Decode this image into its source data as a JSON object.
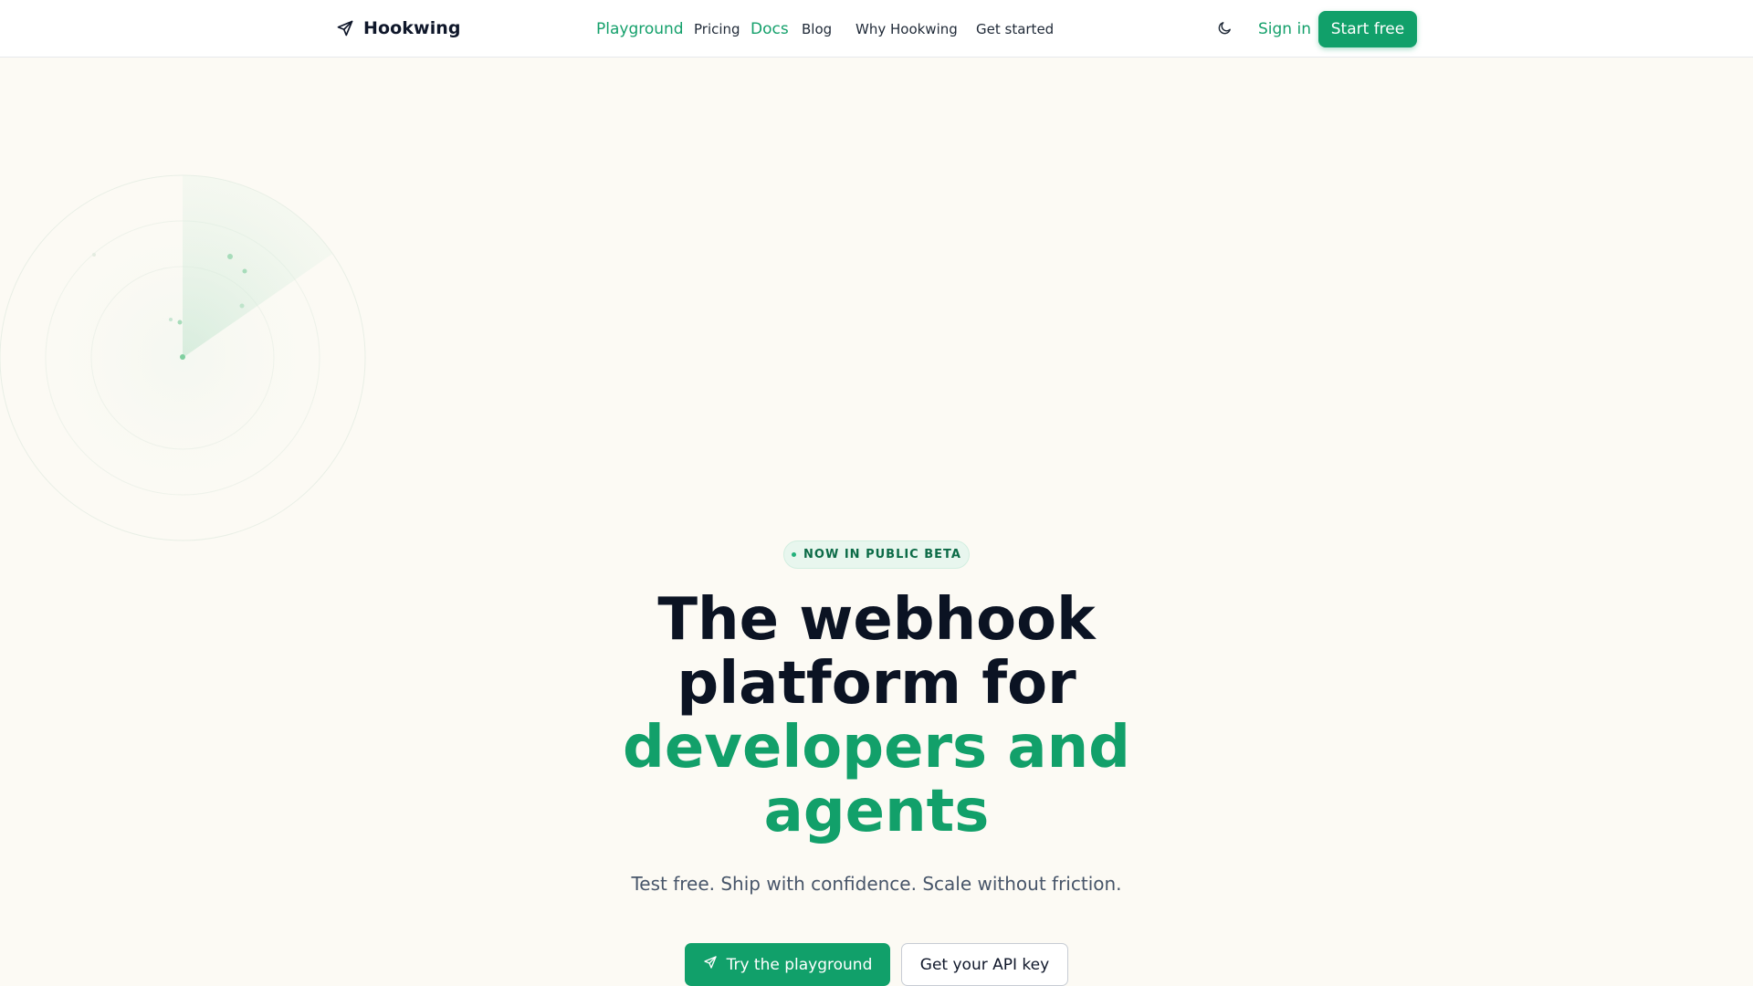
{
  "brand": {
    "name": "Hookwing",
    "icon": "paper-plane-icon"
  },
  "nav": {
    "items": [
      {
        "label": "Playground",
        "accent": true
      },
      {
        "label": "Pricing",
        "accent": false
      },
      {
        "label": "Docs",
        "accent": true
      },
      {
        "label": "Blog",
        "accent": false
      },
      {
        "label": "Why Hookwing",
        "accent": false
      },
      {
        "label": "Get started",
        "accent": false
      }
    ]
  },
  "header_actions": {
    "theme_toggle_icon": "moon-icon",
    "sign_in": "Sign in",
    "start_free": "Start free"
  },
  "hero": {
    "badge": "NOW IN PUBLIC BETA",
    "title_line1": "The webhook",
    "title_line2": "platform for",
    "title_line3": "developers and",
    "title_line4": "agents",
    "subtitle": "Test free. Ship with confidence. Scale without friction.",
    "cta_primary": "Try the playground",
    "cta_primary_icon": "paper-plane-icon",
    "cta_secondary": "Get your API key"
  },
  "colors": {
    "accent": "#12a06a",
    "background": "#fcfaf4",
    "text": "#0b1323"
  }
}
